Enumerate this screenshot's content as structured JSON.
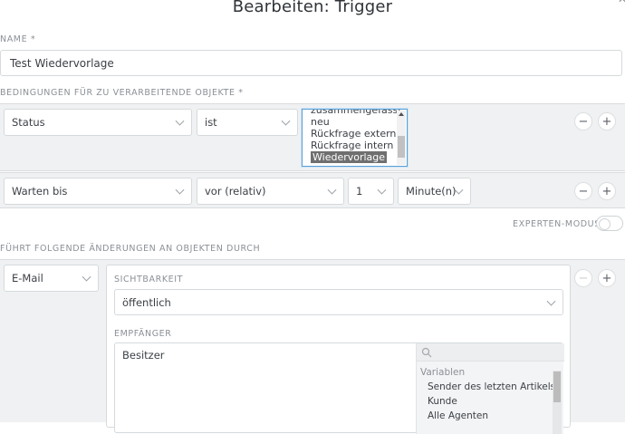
{
  "dialog": {
    "title": "Bearbeiten: Trigger",
    "corner_glyph": "✕"
  },
  "name_field": {
    "label": "NAME *",
    "value": "Test Wiedervorlage"
  },
  "conditions": {
    "label": "BEDINGUNGEN FÜR ZU VERARBEITENDE OBJEKTE *",
    "row1": {
      "attribute": "Status",
      "operator": "ist",
      "options": [
        "zusammengefasst",
        "neu",
        "Rückfrage extern",
        "Rückfrage intern",
        "Wiedervorlage"
      ],
      "selected": "Wiedervorlage"
    },
    "row2": {
      "attribute": "Warten bis",
      "operator": "vor (relativ)",
      "amount": "1",
      "unit": "Minute(n)"
    },
    "remove_glyph": "−",
    "add_glyph": "+"
  },
  "expert_mode": {
    "label": "EXPERTEN-MODUS",
    "enabled": false
  },
  "actions": {
    "label": "FÜHRT FOLGENDE ÄNDERUNGEN AN OBJEKTEN DURCH",
    "type": "E-Mail",
    "visibility_label": "SICHTBARKEIT",
    "visibility_value": "öffentlich",
    "recipient_label": "EMPFÄNGER",
    "recipient_value": "Besitzer",
    "variables_header": "Variablen",
    "variables": [
      "Sender des letzten Artikels",
      "Kunde",
      "Alle Agenten"
    ]
  },
  "colors": {
    "panel_bg": "#eff1f2",
    "selected_option_bg": "#6f6f6f",
    "focus_border": "#5aa0d6"
  }
}
